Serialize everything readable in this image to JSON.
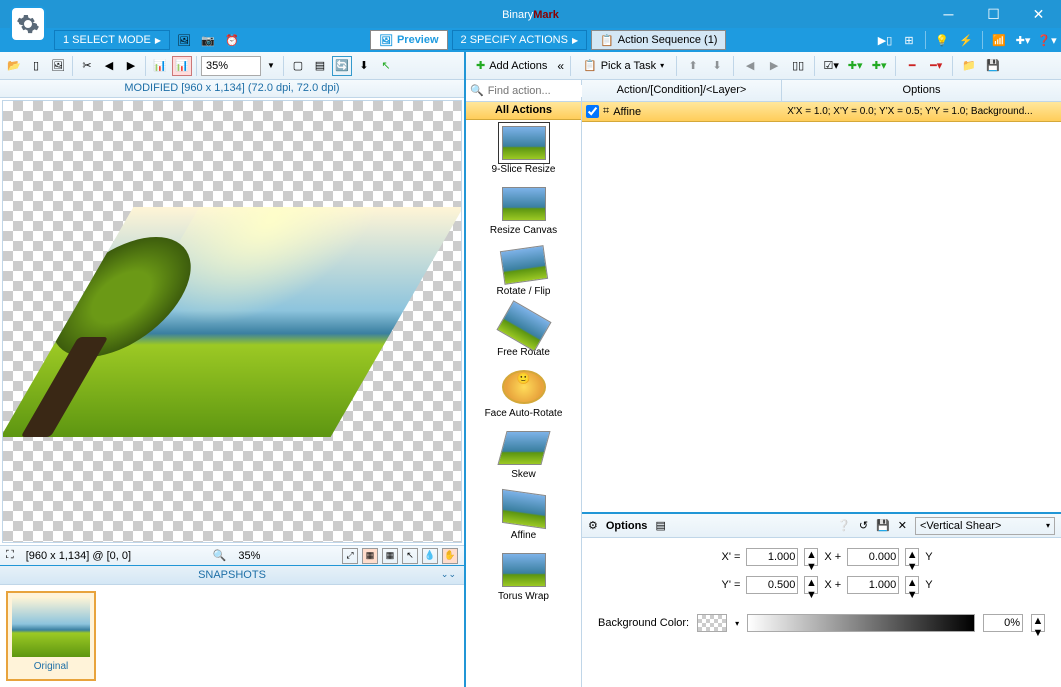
{
  "app": {
    "title_a": "Binary",
    "title_b": "Mark"
  },
  "tabs": {
    "select_mode": "1  SELECT MODE",
    "preview": "Preview",
    "specify_actions": "2  SPECIFY ACTIONS",
    "action_sequence": "Action Sequence (1)"
  },
  "preview": {
    "title": "MODIFIED [960 x 1,134] (72.0 dpi, 72.0 dpi)",
    "zoom": "35%",
    "status_dims": "[960 x 1,134] @ [0, 0]",
    "status_zoom": "35%"
  },
  "snapshots": {
    "header": "SNAPSHOTS",
    "items": [
      {
        "label": "Original"
      }
    ]
  },
  "actions_panel": {
    "add_actions": "Add Actions",
    "find_placeholder": "Find action...",
    "all_actions": "All Actions",
    "pick_task": "Pick a Task",
    "items": [
      {
        "label": "9-Slice Resize"
      },
      {
        "label": "Resize Canvas"
      },
      {
        "label": "Rotate / Flip"
      },
      {
        "label": "Free Rotate"
      },
      {
        "label": "Face Auto-Rotate"
      },
      {
        "label": "Skew"
      },
      {
        "label": "Affine"
      },
      {
        "label": "Torus Wrap"
      }
    ]
  },
  "sequence": {
    "col_action": "Action/[Condition]/<Layer>",
    "col_options": "Options",
    "rows": [
      {
        "name": "Affine",
        "opts": "X'X = 1.0; X'Y = 0.0; Y'X = 0.5; Y'Y = 1.0; Background..."
      }
    ]
  },
  "options": {
    "title": "Options",
    "combo": "<Vertical Shear>",
    "xlabel": "X' =",
    "ylabel": "Y' =",
    "xplus": "X +",
    "y_suffix": "Y",
    "xx": "1.000",
    "xy": "0.000",
    "yx": "0.500",
    "yy": "1.000",
    "bg_label": "Background Color:",
    "alpha": "0%"
  }
}
